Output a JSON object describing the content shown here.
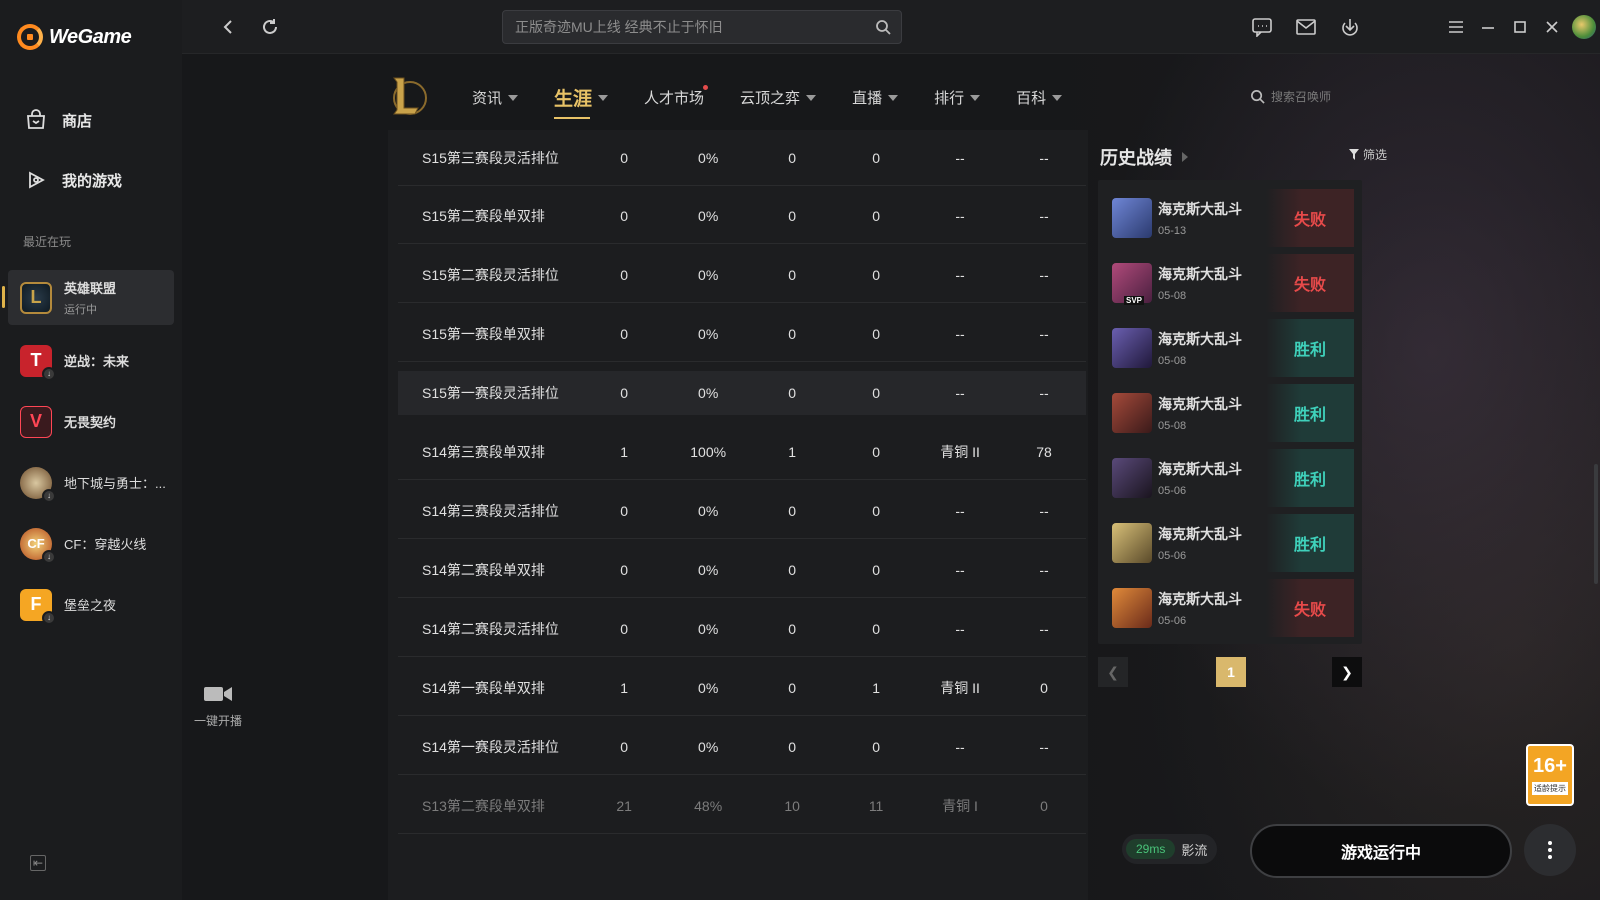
{
  "app": {
    "name": "WeGame"
  },
  "sidebar": {
    "nav": [
      {
        "label": "商店",
        "icon": "shop-icon"
      },
      {
        "label": "我的游戏",
        "icon": "gamepad-icon"
      }
    ],
    "recent_title": "最近在玩",
    "games": [
      {
        "name": "英雄联盟",
        "status": "运行中"
      },
      {
        "name": "逆战：未来"
      },
      {
        "name": "无畏契约"
      },
      {
        "name": "地下城与勇士：..."
      },
      {
        "name": "CF：穿越火线"
      },
      {
        "name": "堡垒之夜"
      }
    ]
  },
  "topbar": {
    "search_placeholder": "正版奇迹MU上线 经典不止于怀旧"
  },
  "game_nav": {
    "items": [
      "资讯",
      "生涯",
      "人才市场",
      "云顶之弈",
      "直播",
      "排行",
      "百科"
    ],
    "active": "生涯",
    "summoner_search_placeholder": "搜索召唤师"
  },
  "career_table": {
    "rows": [
      {
        "name": "S15第三赛段灵活排位",
        "c1": "0",
        "c2": "0%",
        "c3": "0",
        "c4": "0",
        "c5": "--",
        "c6": "--"
      },
      {
        "name": "S15第二赛段单双排",
        "c1": "0",
        "c2": "0%",
        "c3": "0",
        "c4": "0",
        "c5": "--",
        "c6": "--"
      },
      {
        "name": "S15第二赛段灵活排位",
        "c1": "0",
        "c2": "0%",
        "c3": "0",
        "c4": "0",
        "c5": "--",
        "c6": "--"
      },
      {
        "name": "S15第一赛段单双排",
        "c1": "0",
        "c2": "0%",
        "c3": "0",
        "c4": "0",
        "c5": "--",
        "c6": "--"
      },
      {
        "name": "S15第一赛段灵活排位",
        "c1": "0",
        "c2": "0%",
        "c3": "0",
        "c4": "0",
        "c5": "--",
        "c6": "--"
      },
      {
        "name": "S14第三赛段单双排",
        "c1": "1",
        "c2": "100%",
        "c3": "1",
        "c4": "0",
        "c5": "青铜 II",
        "c6": "78"
      },
      {
        "name": "S14第三赛段灵活排位",
        "c1": "0",
        "c2": "0%",
        "c3": "0",
        "c4": "0",
        "c5": "--",
        "c6": "--"
      },
      {
        "name": "S14第二赛段单双排",
        "c1": "0",
        "c2": "0%",
        "c3": "0",
        "c4": "0",
        "c5": "--",
        "c6": "--"
      },
      {
        "name": "S14第二赛段灵活排位",
        "c1": "0",
        "c2": "0%",
        "c3": "0",
        "c4": "0",
        "c5": "--",
        "c6": "--"
      },
      {
        "name": "S14第一赛段单双排",
        "c1": "1",
        "c2": "0%",
        "c3": "0",
        "c4": "1",
        "c5": "青铜 II",
        "c6": "0"
      },
      {
        "name": "S14第一赛段灵活排位",
        "c1": "0",
        "c2": "0%",
        "c3": "0",
        "c4": "0",
        "c5": "--",
        "c6": "--"
      },
      {
        "name": "S13第二赛段单双排",
        "c1": "21",
        "c2": "48%",
        "c3": "10",
        "c4": "11",
        "c5": "青铜 I",
        "c6": "0"
      }
    ]
  },
  "history": {
    "title": "历史战绩",
    "filter_label": "筛选",
    "matches": [
      {
        "mode": "海克斯大乱斗",
        "date": "05-13",
        "result": "失败",
        "outcome": "lose",
        "color": "#5a6fb0"
      },
      {
        "mode": "海克斯大乱斗",
        "date": "05-08",
        "result": "失败",
        "outcome": "lose",
        "color": "#8a3f6a",
        "badge": "SVP"
      },
      {
        "mode": "海克斯大乱斗",
        "date": "05-08",
        "result": "胜利",
        "outcome": "win",
        "color": "#4a3f7a"
      },
      {
        "mode": "海克斯大乱斗",
        "date": "05-08",
        "result": "胜利",
        "outcome": "win",
        "color": "#7a3a3a"
      },
      {
        "mode": "海克斯大乱斗",
        "date": "05-06",
        "result": "胜利",
        "outcome": "win",
        "color": "#3a2f4a"
      },
      {
        "mode": "海克斯大乱斗",
        "date": "05-06",
        "result": "胜利",
        "outcome": "win",
        "color": "#9a8a4a"
      },
      {
        "mode": "海克斯大乱斗",
        "date": "05-06",
        "result": "失败",
        "outcome": "lose",
        "color": "#b0602a"
      }
    ],
    "page": "1"
  },
  "stream_label": "一键开播",
  "ping": {
    "ms": "29ms",
    "server": "影流"
  },
  "run_button": "游戏运行中",
  "age_rating": {
    "number": "16+",
    "text": "适龄提示"
  }
}
